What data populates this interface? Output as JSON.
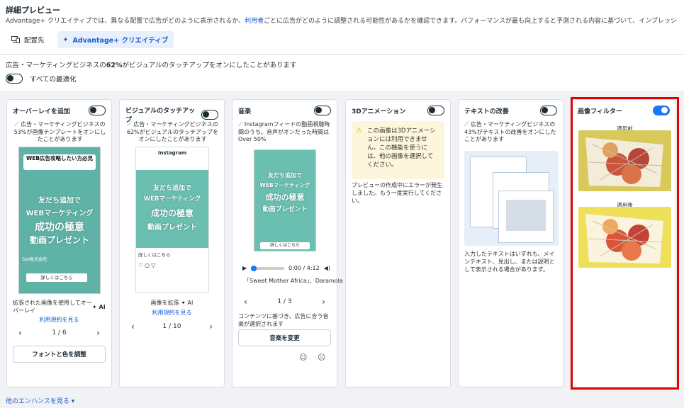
{
  "header": {
    "title": "詳細プレビュー",
    "subtitle_pre": "Advantage+ クリエイティブでは、異なる配置で広告がどのように表示されるか、",
    "subtitle_link": "利用者",
    "subtitle_post": "ごとに広告がどのように調整される可能性があるかを確認できます。パフォーマンスが最も向上すると予測される内容に基づいて、インプレッシ"
  },
  "tabs": [
    {
      "label": "配置先",
      "active": false
    },
    {
      "label": "Advantage+ クリエイティブ",
      "active": true
    }
  ],
  "info_pre": "広告・マーケティングビジネスの",
  "info_bold": "62%",
  "info_post": "がビジュアルのタッチアップをオンにしたことがあります",
  "all_optimize_label": "すべての最適化",
  "cards": {
    "overlay": {
      "title": "オーバーレイを追加",
      "desc": "広告・マーケティングビジネスの53%が画像テンプレートをオンにしたことがあります",
      "banner": "WEB広告攻略したい方必見",
      "line1": "友だち追加で",
      "line2": "WEBマーケティング",
      "line3": "成功の極意",
      "line4": "動画プレゼント",
      "cta": "詳しくはこちら",
      "account": "Sie株式会社",
      "caption": "拡張された画像を使用してオーバーレイ",
      "ai": "AI",
      "link": "利用規約を見る",
      "pager": "1 / 6",
      "button": "フォントと色を調整"
    },
    "visual": {
      "title": "ビジュアルのタッチアップ",
      "desc": "広告・マーケティングビジネスの62%がビジュアルのタッチアップをオンにしたことがあります",
      "ig": "Instagram",
      "line1": "友だち追加で",
      "line2": "WEBマーケティング",
      "line3": "成功の極意",
      "line4": "動画プレゼント",
      "cta": "詳しくはこちら",
      "caption": "画像を拡張",
      "ai": "AI",
      "link": "利用規約を見る",
      "pager": "1 / 10"
    },
    "music": {
      "title": "音楽",
      "desc": "Instagramフィードの動画視聴時間のうち、音声がオンだった時間はOver 50%",
      "line1": "友だち追加で",
      "line2": "WEBマーケティング",
      "line3": "成功の極意",
      "line4": "動画プレゼント",
      "cta": "詳しくはこちら",
      "time": "0:00 / 4:12",
      "track": "「Sweet Mother Africa」、Daramola",
      "pager": "1 / 3",
      "note": "コンテンツに基づき、広告に合う音楽が選択されます",
      "button": "音楽を変更"
    },
    "anim3d": {
      "title": "3Dアニメーション",
      "warn": "この画像は3Dアニメーションには利用できません。この機能を使うには、他の画像を選択してください。",
      "error": "プレビューの作成中にエラーが発生しました。もう一度実行してください。"
    },
    "text": {
      "title": "テキストの改善",
      "desc": "広告・マーケティングビジネスの43%がテキストの改善をオンにしたことがあります",
      "note": "入力したテキストはいずれも、メインテキスト、見出し、または説明として表示される場合があります。"
    },
    "filter": {
      "title": "画像フィルター",
      "before": "適用前",
      "after": "適用後"
    }
  },
  "footer_link": "他のエンハンスを見る"
}
